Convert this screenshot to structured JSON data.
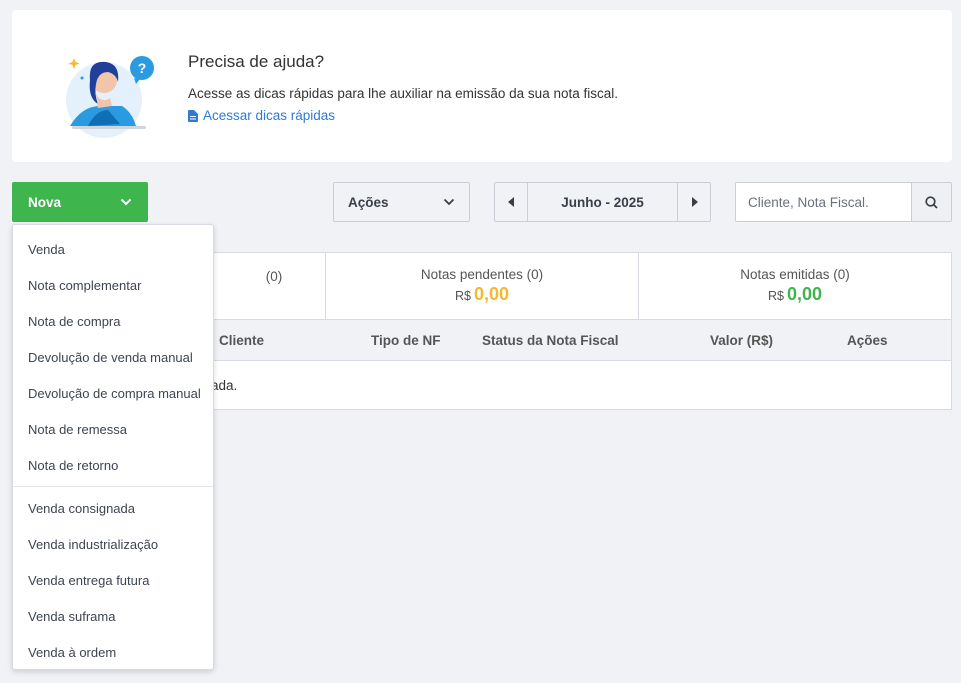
{
  "help": {
    "title": "Precisa de ajuda?",
    "description": "Acesse as dicas rápidas para lhe auxiliar na emissão da sua nota fiscal.",
    "link": "Acessar dicas rápidas",
    "link_icon": "document-icon",
    "illustration": "woman-thinking-question-illustration"
  },
  "toolbar": {
    "new_button": "Nova",
    "actions_select": "Ações",
    "month": "Junho - 2025",
    "search_placeholder": "Cliente, Nota Fiscal."
  },
  "summary": [
    {
      "label": "(0)",
      "currency": "",
      "value": ""
    },
    {
      "label": "Notas pendentes (0)",
      "currency": "R$",
      "value": "0,00",
      "color": "#f5b82e"
    },
    {
      "label": "Notas emitidas (0)",
      "currency": "R$",
      "value": "0,00",
      "color": "#3fb54d"
    }
  ],
  "table": {
    "headers": [
      "Cliente",
      "Tipo de NF",
      "Status da Nota Fiscal",
      "Valor (R$)",
      "Ações"
    ],
    "empty_message": "ada."
  },
  "dropdown": {
    "group1": [
      "Venda",
      "Nota complementar",
      "Nota de compra",
      "Devolução de venda manual",
      "Devolução de compra manual",
      "Nota de remessa",
      "Nota de retorno"
    ],
    "group2": [
      "Venda consignada",
      "Venda industrialização",
      "Venda entrega futura",
      "Venda suframa",
      "Venda à ordem"
    ]
  },
  "colors": {
    "primary_green": "#3fb54d",
    "pending_yellow": "#f5b82e",
    "link_blue": "#2f7bd4"
  }
}
